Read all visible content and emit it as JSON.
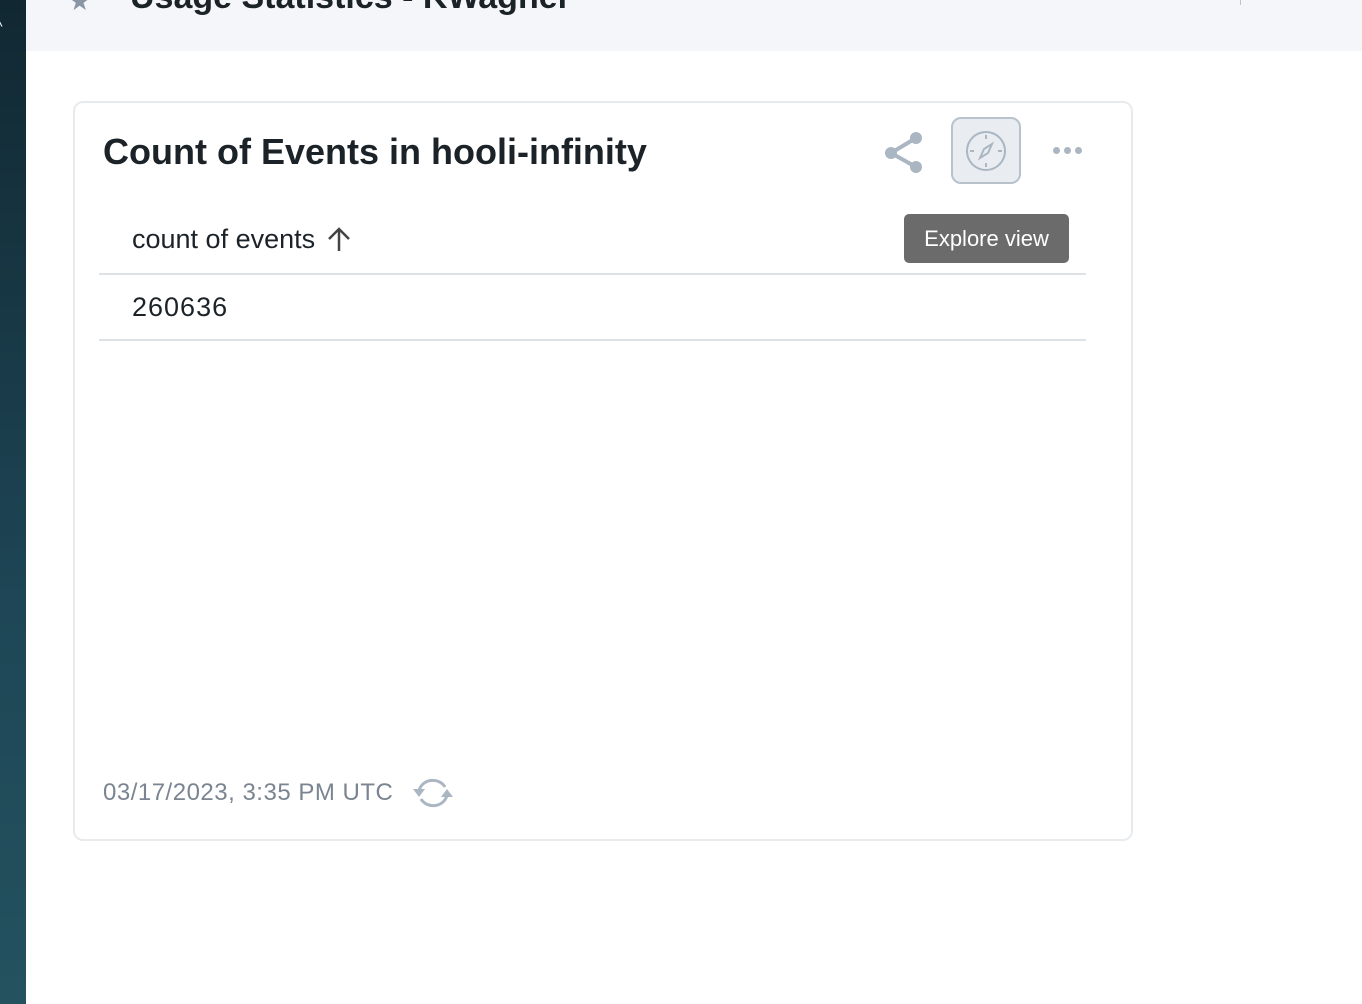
{
  "header": {
    "title": "Usage Statistics - KWagner"
  },
  "card": {
    "title": "Count of Events in hooli-infinity",
    "tooltip": "Explore view",
    "table": {
      "columns": [
        "count of events"
      ],
      "rows": [
        [
          "260636"
        ]
      ]
    },
    "timestamp": "03/17/2023, 3:35 PM UTC"
  }
}
